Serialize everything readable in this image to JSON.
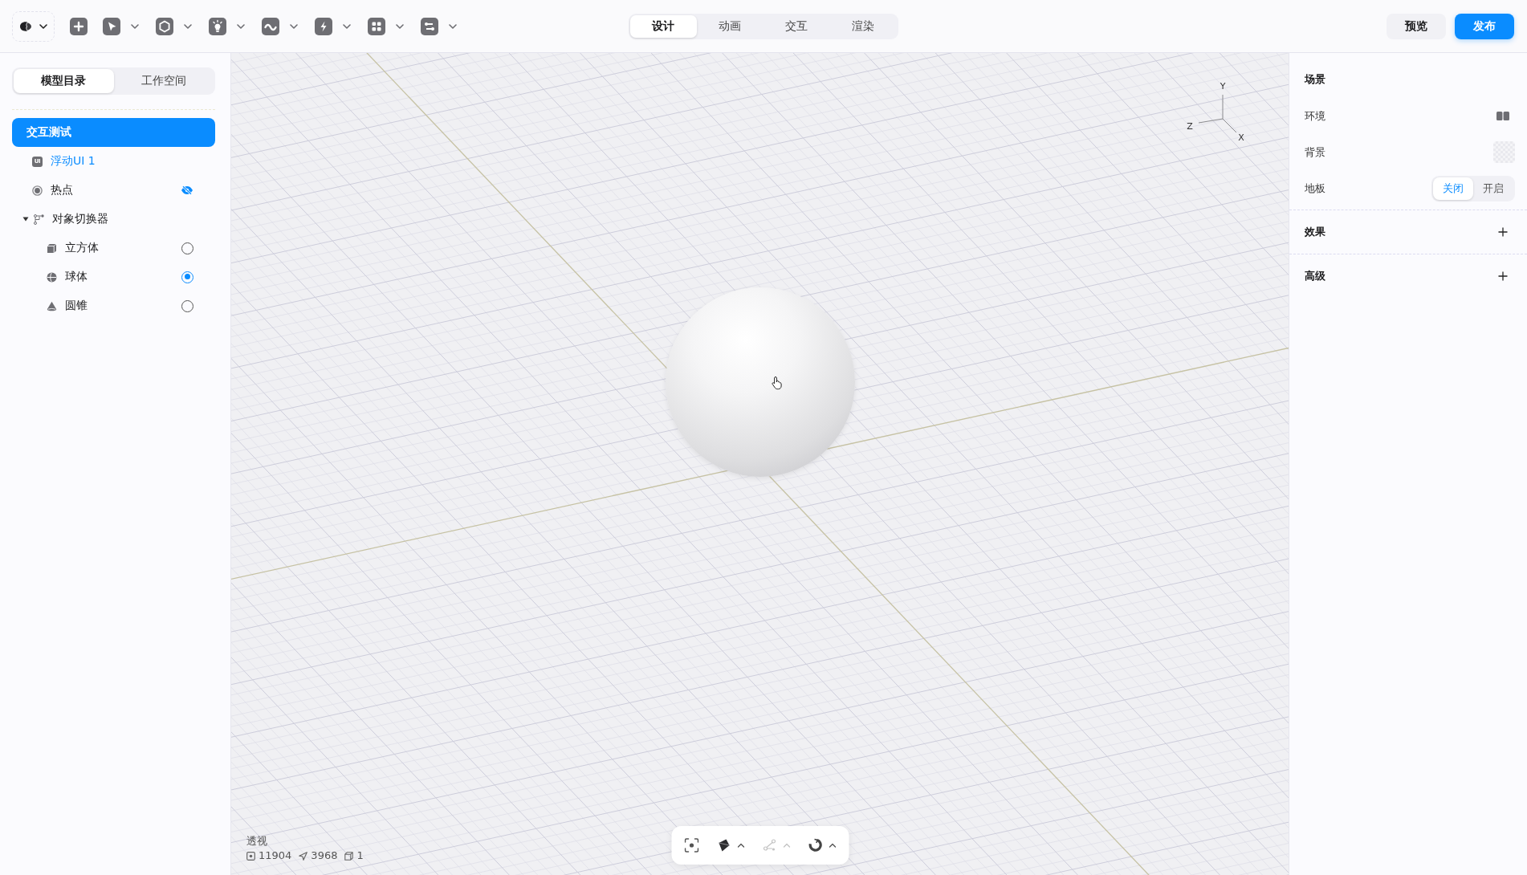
{
  "mode_tabs": [
    {
      "label": "设计",
      "selected": true
    },
    {
      "label": "动画",
      "selected": false
    },
    {
      "label": "交互",
      "selected": false
    },
    {
      "label": "渲染",
      "selected": false
    }
  ],
  "actions": [
    {
      "label": "预览",
      "kind": "secondary"
    },
    {
      "label": "发布",
      "kind": "primary"
    }
  ],
  "sidebar": {
    "tabs": [
      {
        "label": "模型目录",
        "selected": true
      },
      {
        "label": "工作空间",
        "selected": false
      }
    ],
    "tree": [
      {
        "label": "交互测试",
        "selected": true,
        "children": [
          {
            "label": "浮动UI 1",
            "kind": "ui",
            "badge": "UI",
            "selected": false,
            "highlighted": true,
            "hidden": false
          },
          {
            "label": "热点",
            "kind": "hotspot",
            "selected": false,
            "highlighted": false,
            "hidden": true
          },
          {
            "label": "对象切换器",
            "kind": "switcher",
            "selected": false,
            "highlighted": false,
            "hidden": false,
            "expanded": true,
            "children": [
              {
                "label": "立方体",
                "kind": "cube",
                "selected": false,
                "checked": false
              },
              {
                "label": "球体",
                "kind": "sphere",
                "selected": false,
                "checked": true
              },
              {
                "label": "圆锥",
                "kind": "cone",
                "selected": false,
                "checked": false
              }
            ]
          }
        ]
      }
    ]
  },
  "viewport": {
    "axis_labels": {
      "y": "Y",
      "z": "Z",
      "x": "X"
    },
    "projection": "透视",
    "stats": [
      {
        "kind": "vertices",
        "value": "11904"
      },
      {
        "kind": "faces",
        "value": "3968"
      },
      {
        "kind": "objects",
        "value": "1"
      }
    ],
    "tools": [
      {
        "kind": "focus",
        "has_menu": false,
        "disabled": false
      },
      {
        "kind": "shading",
        "has_menu": true,
        "disabled": false
      },
      {
        "kind": "nodes",
        "has_menu": true,
        "disabled": true
      },
      {
        "kind": "magnet",
        "has_menu": true,
        "disabled": false
      }
    ]
  },
  "inspector": {
    "sections": [
      {
        "title": "场景",
        "expanded": true,
        "rows": [
          {
            "label": "环境",
            "kind": "environment"
          },
          {
            "label": "背景",
            "kind": "swatch"
          },
          {
            "label": "地板",
            "kind": "toggle",
            "options": [
              {
                "label": "关闭",
                "selected": true
              },
              {
                "label": "开启",
                "selected": false
              }
            ]
          }
        ]
      },
      {
        "title": "效果",
        "expanded": false
      },
      {
        "title": "高级",
        "expanded": false
      }
    ]
  }
}
